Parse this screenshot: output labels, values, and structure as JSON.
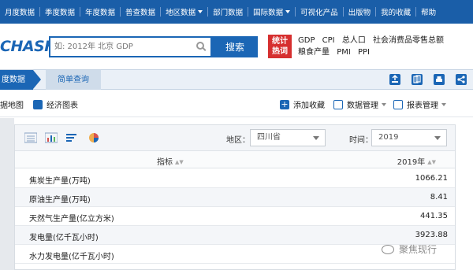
{
  "topnav": {
    "items": [
      "月度数据",
      "季度数据",
      "年度数据",
      "普查数据",
      "地区数据",
      "部门数据",
      "国际数据",
      "可视化产品",
      "出版物",
      "我的收藏",
      "帮助"
    ]
  },
  "header": {
    "logo_text": "CHASHU",
    "search_placeholder": "如: 2012年 北京 GDP",
    "search_button": "搜索",
    "tjrc_badge": "统计\n热词",
    "hot_links": [
      "GDP",
      "CPI",
      "总人口",
      "社会消费品零售总额",
      "粮食产量",
      "PMI",
      "PPI"
    ]
  },
  "tabs": {
    "active": "度数据",
    "simple_query": "简单查询"
  },
  "toolbar": {
    "map_label": "据地图",
    "chart_label": "经济图表",
    "add_fav_label": "添加收藏",
    "data_mgmt_label": "数据管理",
    "report_mgmt_label": "报表管理"
  },
  "filters": {
    "region_label": "地区：",
    "region_value": "四川省",
    "time_label": "时间：",
    "time_value": "2019"
  },
  "table": {
    "col_indicator": "指标",
    "col_year": "2019年",
    "rows": [
      {
        "name": "焦炭生产量(万吨)",
        "value": "1066.21"
      },
      {
        "name": "原油生产量(万吨)",
        "value": "8.41"
      },
      {
        "name": "天然气生产量(亿立方米)",
        "value": "441.35"
      },
      {
        "name": "发电量(亿千瓦小时)",
        "value": "3923.88"
      },
      {
        "name": "水力发电量(亿千瓦小时)",
        "value": ""
      }
    ]
  },
  "watermark": "聚焦现行"
}
